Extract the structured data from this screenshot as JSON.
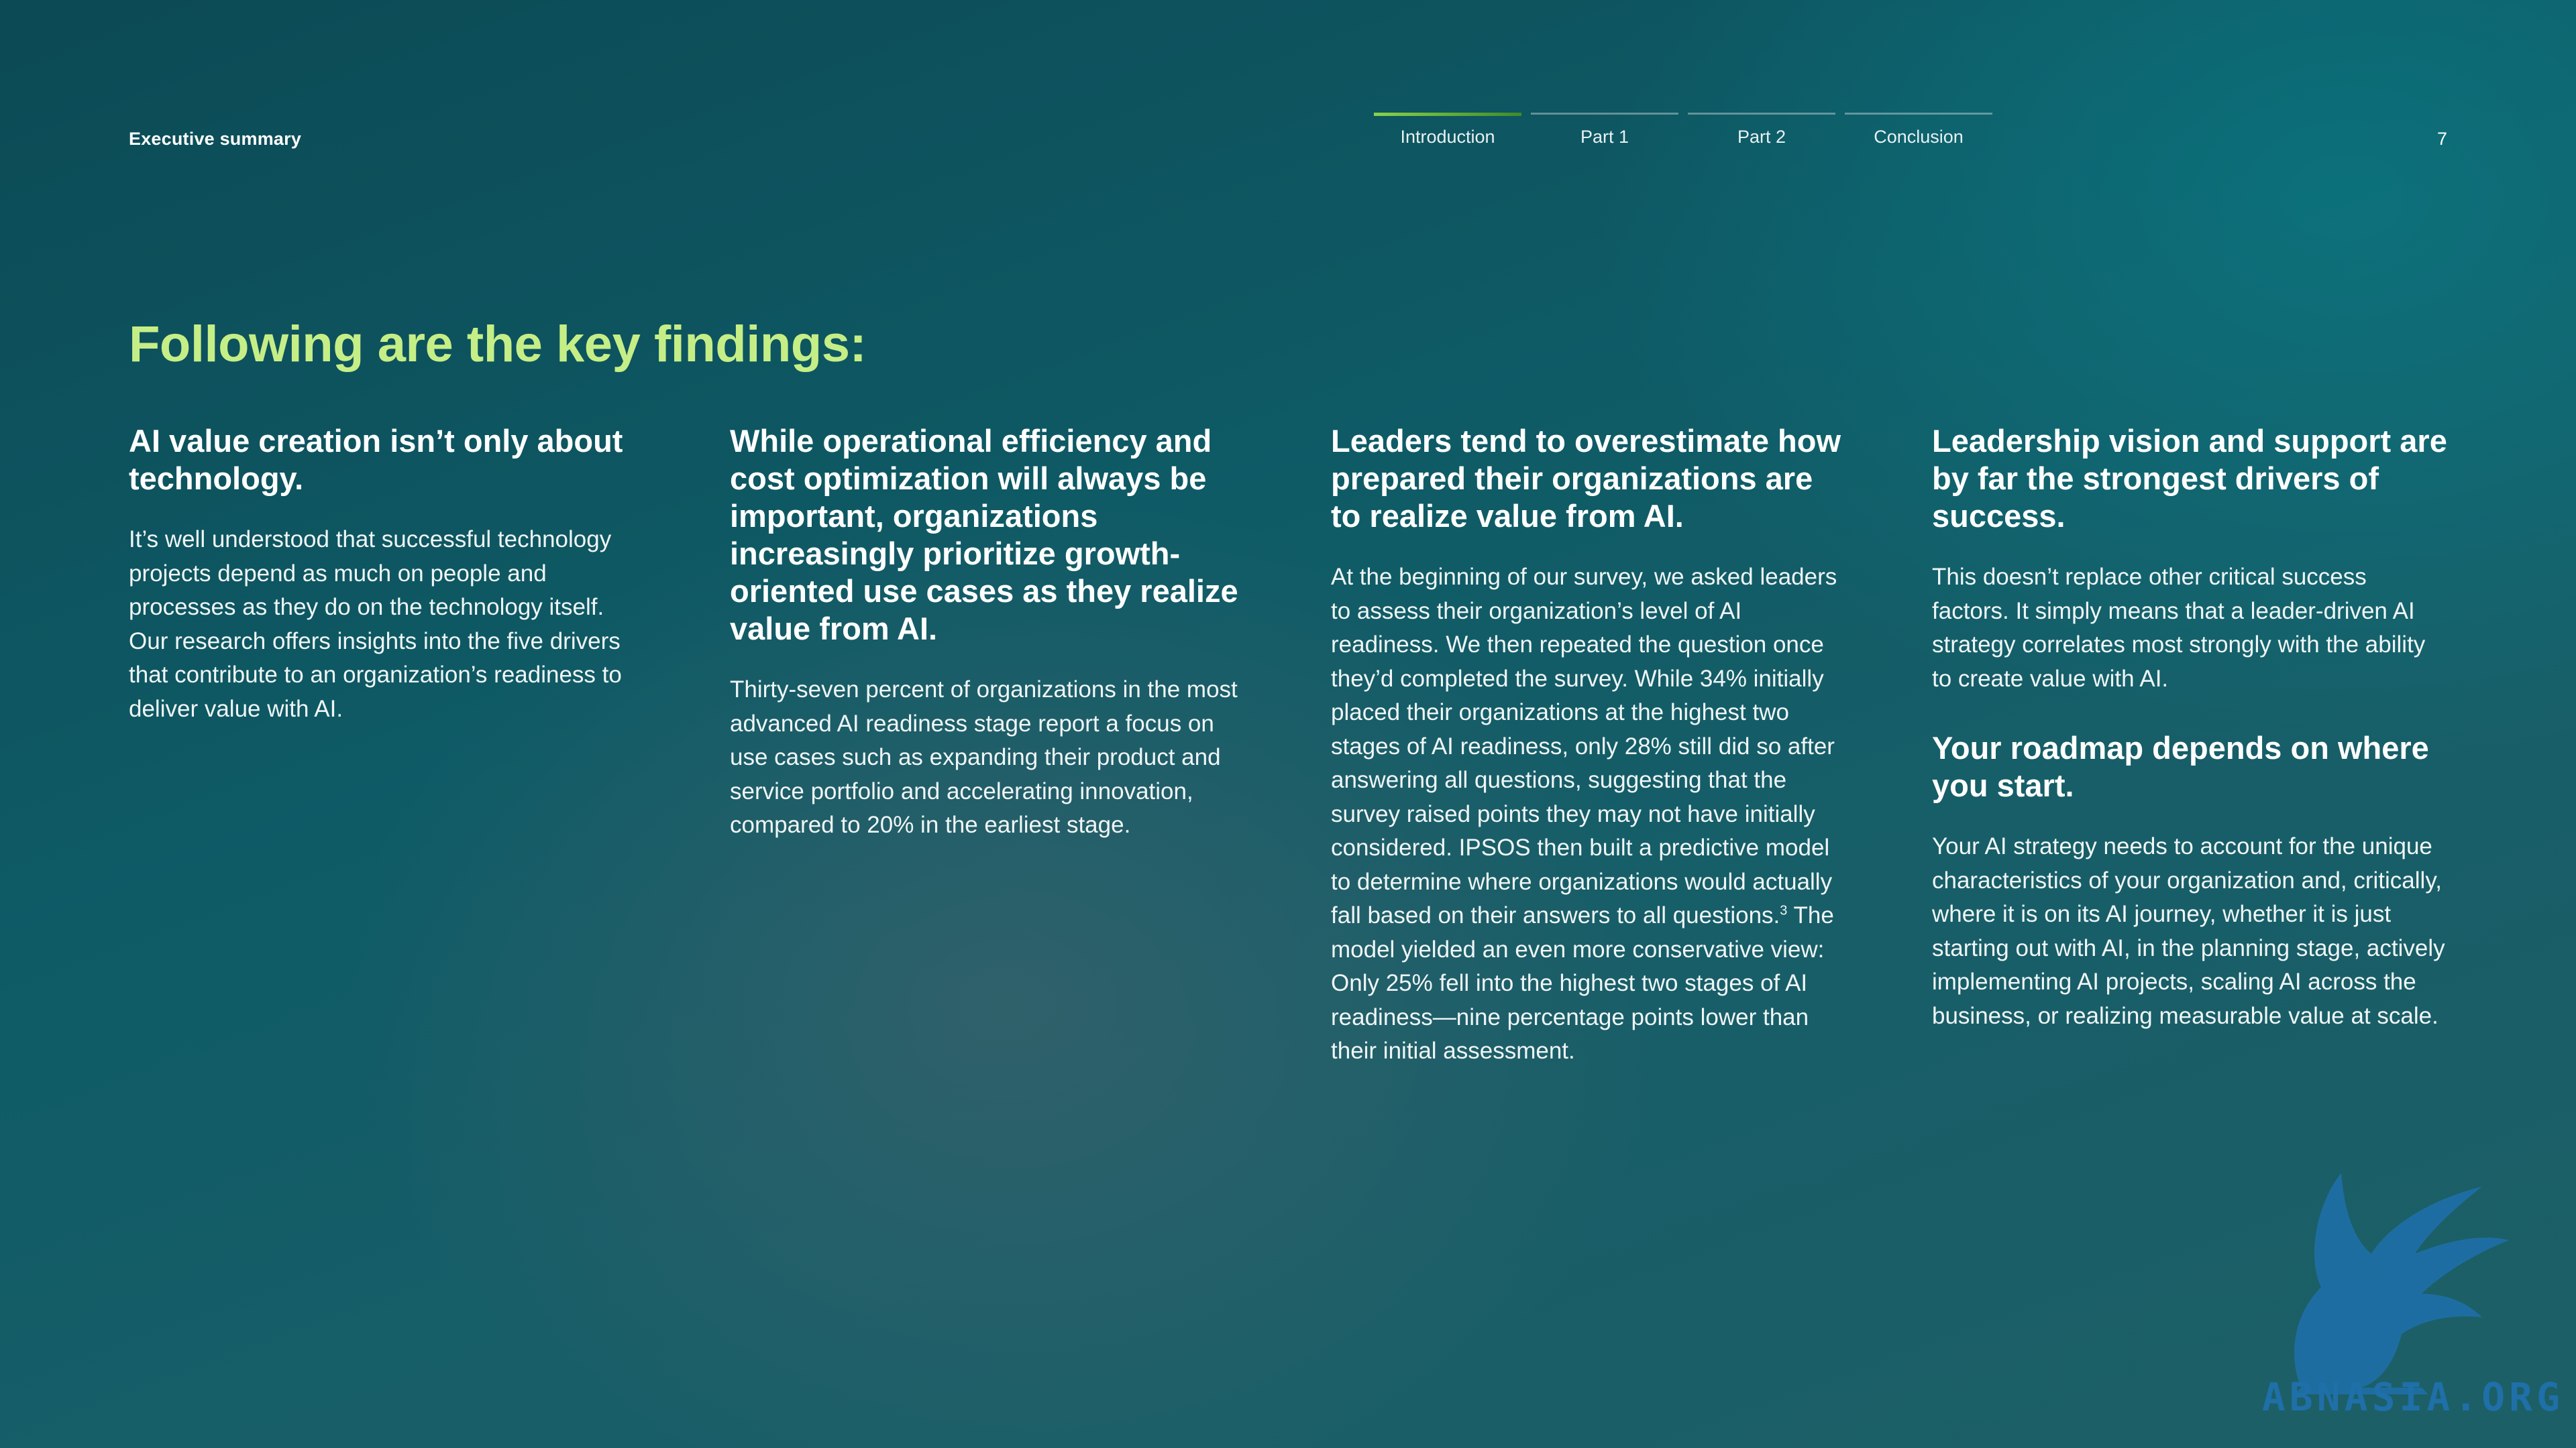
{
  "header": {
    "section": "Executive summary",
    "tabs": [
      {
        "label": "Introduction"
      },
      {
        "label": "Part 1"
      },
      {
        "label": "Part 2"
      },
      {
        "label": "Conclusion"
      }
    ],
    "active_tab": "Introduction",
    "page_number": "7"
  },
  "title": "Following are the key findings:",
  "columns": [
    {
      "heading": "AI value creation isn’t only about technology.",
      "body": "It’s well understood that successful technology projects depend as much on people and processes as they do on the technology itself. Our research offers insights into the five drivers that contribute to an organization’s readiness to deliver value with AI."
    },
    {
      "heading": "While operational efficiency and cost optimization will always be important, organizations increasingly prioritize growth-oriented use cases as they realize value from AI.",
      "body": "Thirty-seven percent of organizations in the most advanced AI readiness stage report a focus on use cases such as expanding their product and service portfolio and accelerating innovation, compared to 20% in the earliest stage."
    },
    {
      "heading": "Leaders tend to overestimate how prepared their organizations are to realize value from AI.",
      "body_part1": "At the beginning of our survey, we asked leaders to assess their organization’s level of AI readiness. We then repeated the question once they’d completed the survey. While 34% initially placed their organizations at the highest two stages of AI readiness, only 28% still did so after answering all questions, suggesting that the survey raised points they may not have initially considered. IPSOS then built a predictive model to determine where organizations would actually fall based on their answers to all questions.",
      "footnote": "3",
      "body_part2": " The model yielded an even more conservative view: Only 25% fell into the highest two stages of AI readiness—nine percentage points lower than their initial assessment."
    },
    {
      "heading": "Leadership vision and support are by far the strongest drivers of success.",
      "body": "This doesn’t replace other critical success factors. It simply means that a leader-driven AI strategy correlates most strongly with the ability to create value with AI.",
      "heading2": "Your roadmap depends on where you start.",
      "body2": "Your AI strategy needs to account for the unique characteristics of your organization and, critically, where it is on its AI journey, whether it is just starting out with AI, in the planning stage, actively implementing AI projects, scaling AI across the business, or realizing measurable value at scale."
    }
  ],
  "watermark": {
    "text": "ABNASIA.ORG",
    "icon": "griffin-logo-icon",
    "color": "#1f6fa8"
  },
  "colors": {
    "title": "#c5ee86",
    "active_tab_bar": "#6fbf3a"
  }
}
